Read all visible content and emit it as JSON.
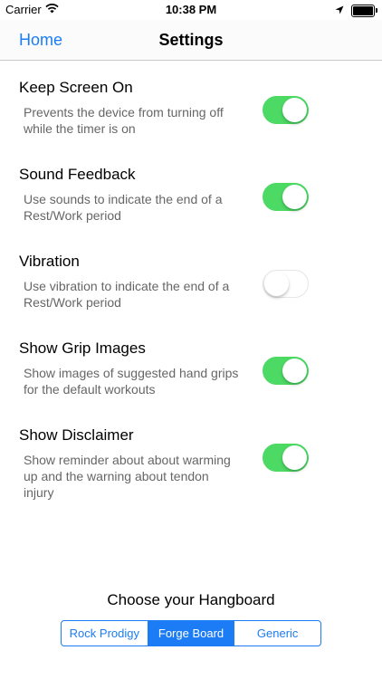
{
  "status_bar": {
    "carrier": "Carrier",
    "time": "10:38 PM"
  },
  "nav": {
    "back_label": "Home",
    "title": "Settings"
  },
  "settings": [
    {
      "title": "Keep Screen On",
      "description": "Prevents the device from turning off while the timer is on",
      "enabled": true
    },
    {
      "title": "Sound Feedback",
      "description": "Use sounds to indicate the end of a Rest/Work period",
      "enabled": true
    },
    {
      "title": "Vibration",
      "description": "Use vibration to indicate the end of a Rest/Work period",
      "enabled": false
    },
    {
      "title": "Show Grip Images",
      "description": "Show images of suggested hand grips for the default workouts",
      "enabled": true
    },
    {
      "title": "Show Disclaimer",
      "description": "Show reminder about about warming up and the warning about tendon injury",
      "enabled": true
    }
  ],
  "hangboard": {
    "title": "Choose your Hangboard",
    "options": [
      "Rock Prodigy",
      "Forge Board",
      "Generic"
    ],
    "selected_index": 1
  },
  "colors": {
    "accent": "#1b7cf5",
    "toggle_on": "#4cd964"
  },
  "icons": {
    "wifi": "wifi-icon",
    "location": "location-arrow-icon",
    "battery": "battery-icon"
  }
}
